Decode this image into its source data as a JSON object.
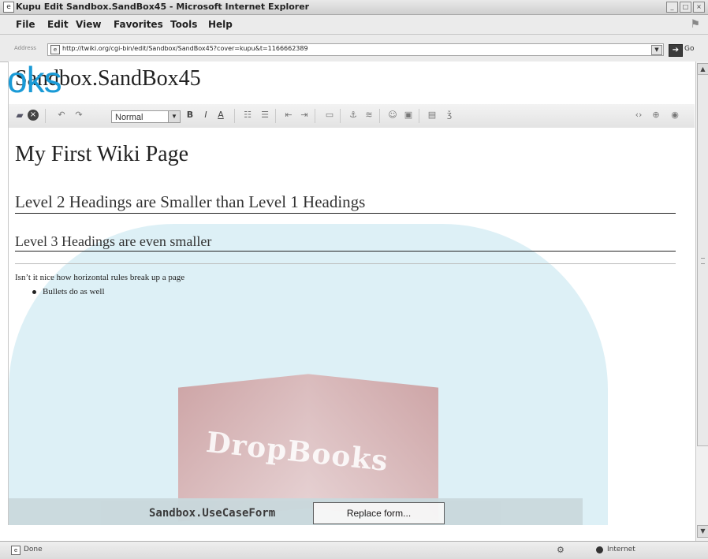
{
  "window": {
    "title": "Kupu Edit Sandbox.SandBox45 - Microsoft Internet Explorer",
    "controls": [
      "minimize-icon",
      "maximize-icon",
      "close-icon"
    ]
  },
  "menu": {
    "items": [
      "File",
      "Edit",
      "View",
      "Favorites",
      "Tools",
      "Help"
    ]
  },
  "address": {
    "label": "Address",
    "url": "http://twiki.org/cgi-bin/edit/Sandbox/SandBox45?cover=kupu&t=1166662389",
    "go_label": "Go"
  },
  "page": {
    "title": "Sandbox.SandBox45",
    "brand_overlay": "oks"
  },
  "toolbar": {
    "style_value": "Normal",
    "icons": [
      "save-icon",
      "cancel-icon",
      "undo-icon",
      "redo-icon",
      "bold-icon",
      "italic-icon",
      "text-color-icon",
      "numbered-list-icon",
      "bulleted-list-icon",
      "outdent-icon",
      "indent-icon",
      "table-icon",
      "insert-link-icon",
      "anchor-icon",
      "smiley-icon",
      "insert-image-icon",
      "variable-icon",
      "special-chars-icon",
      "source-toggle-icon",
      "zoom-icon",
      "help-icon"
    ]
  },
  "editor": {
    "h1": "My First Wiki Page",
    "h2": "Level 2 Headings are Smaller than Level 1 Headings",
    "h3": "Level 3 Headings are even smaller",
    "paragraph": "Isn’t it nice how horizontal rules break up a page",
    "bullets": [
      "Bullets do as well"
    ]
  },
  "watermark": {
    "text": "DropBooks"
  },
  "form": {
    "name": "Sandbox.UseCaseForm",
    "replace_label": "Replace form..."
  },
  "status": {
    "text": "Done",
    "zone": "Internet"
  }
}
